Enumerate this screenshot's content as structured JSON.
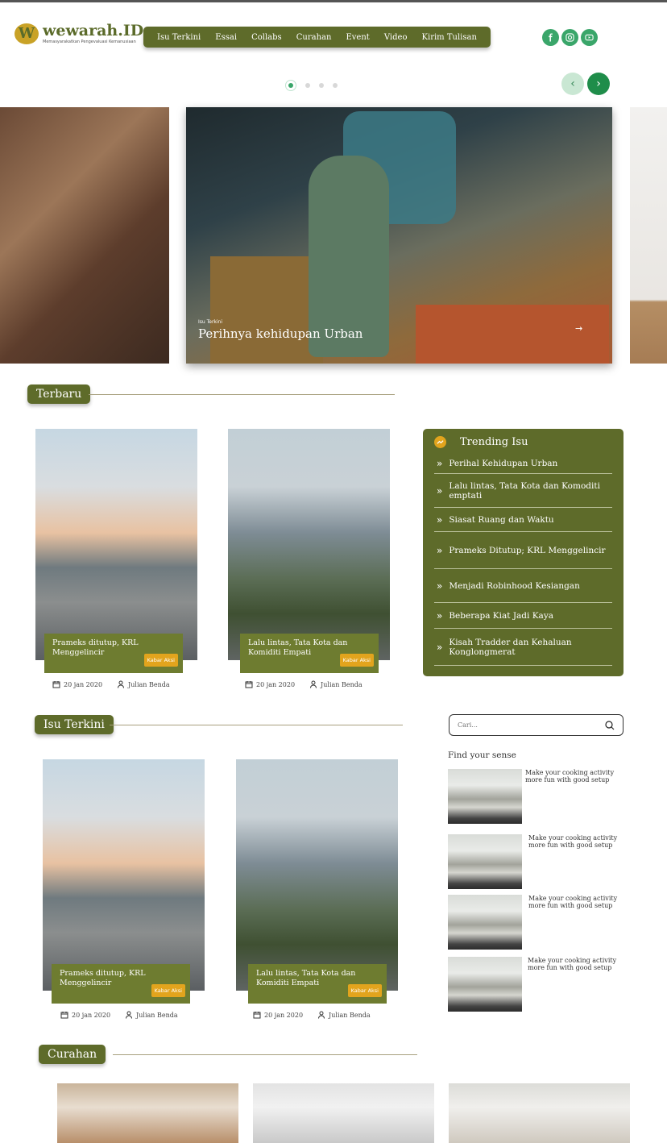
{
  "brand": {
    "name": "wewarah.ID",
    "tagline": "Memasyarakatkan Pengevaluasi Kemanusiaan",
    "mark": "W"
  },
  "nav": [
    "Isu Terkini",
    "Essai",
    "Collabs",
    "Curahan",
    "Event",
    "Video",
    "Kirim Tulisan"
  ],
  "socials": [
    "facebook-icon",
    "instagram-icon",
    "youtube-icon"
  ],
  "hero": {
    "category": "Isu Terkini",
    "title": "Perihnya kehidupan Urban"
  },
  "sections": {
    "latest": "Terbaru",
    "current": "Isu Terkini",
    "outpour": "Curahan"
  },
  "latest_cards": [
    {
      "title": "Prameks ditutup, KRL Menggelincir",
      "badge": "Kabar Aksi",
      "date": "20 jan 2020",
      "author": "Julian Benda"
    },
    {
      "title": "Lalu lintas, Tata Kota dan Komiditi Empati",
      "badge": "Kabar Aksi",
      "date": "20 jan 2020",
      "author": "Julian Benda"
    }
  ],
  "current_cards": [
    {
      "title": "Prameks ditutup, KRL Menggelincir",
      "badge": "Kabar Aksi",
      "date": "20 jan 2020",
      "author": "Julian Benda"
    },
    {
      "title": "Lalu lintas, Tata Kota dan Komiditi Empati",
      "badge": "Kabar Aksi",
      "date": "20 jan 2020",
      "author": "Julian Benda"
    }
  ],
  "trending": {
    "title": "Trending Isu",
    "items": [
      "Perihal Kehidupan Urban",
      "Lalu lintas, Tata Kota dan Komoditi emptati",
      "Siasat Ruang dan Waktu",
      "Prameks Ditutup; KRL Menggelincir",
      "Menjadi Robinhood Kesiangan",
      "Beberapa Kiat Jadi Kaya",
      "Kisah Tradder dan Kehaluan Konglongmerat"
    ]
  },
  "search": {
    "placeholder": "Cari..."
  },
  "find": {
    "title": "Find your sense",
    "items": [
      "Make your cooking activity more fun with good setup",
      "Make your cooking activity more fun with good setup",
      "Make your cooking activity more fun with good setup",
      "Make your cooking activity more fun with good setup"
    ]
  },
  "colors": {
    "olive": "#5e6b2a",
    "gold": "#e2a41d",
    "green": "#3aa66a"
  }
}
